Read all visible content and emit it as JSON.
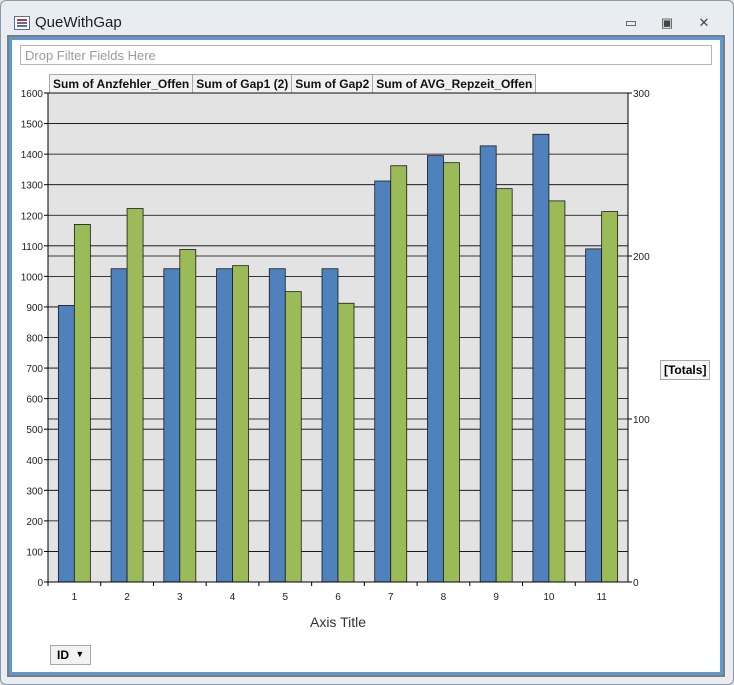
{
  "window": {
    "title": "QueWithGap",
    "minimize": "▭",
    "restore": "▣",
    "close": "✕"
  },
  "filter_placeholder": "Drop Filter Fields Here",
  "data_fields": [
    "Sum of Anzfehler_Offen",
    "Sum of Gap1 (2)",
    "Sum of Gap2",
    "Sum of AVG_Repzeit_Offen"
  ],
  "series_field": "[Totals]",
  "category_field": {
    "label": "ID",
    "arrow": "▼"
  },
  "colors": {
    "blue": "#4f81bd",
    "green": "#9bbb59",
    "plot_bg": "#e3e3e3"
  },
  "chart_data": {
    "type": "bar",
    "xlabel": "Axis Title",
    "categories": [
      "1",
      "2",
      "3",
      "4",
      "5",
      "6",
      "7",
      "8",
      "9",
      "10",
      "11"
    ],
    "left_axis": {
      "ylim": [
        0,
        1600
      ],
      "ticks": [
        "0",
        "100",
        "200",
        "300",
        "400",
        "500",
        "600",
        "700",
        "800",
        "900",
        "1000",
        "1100",
        "1200",
        "1300",
        "1400",
        "1500",
        "1600"
      ]
    },
    "right_axis": {
      "ylim": [
        0,
        300
      ],
      "ticks": [
        "0",
        "100",
        "200",
        "300"
      ]
    },
    "grid": true,
    "series": [
      {
        "name": "Sum of Anzfehler_Offen",
        "color": "#4f81bd",
        "values": [
          905,
          1025,
          1025,
          1025,
          1025,
          1025,
          1312,
          1395,
          1427,
          1465,
          1090
        ]
      },
      {
        "name": "Sum of Gap1 (2)",
        "color": "#9bbb59",
        "values": [
          1170,
          1222,
          1088,
          1035,
          950,
          912,
          1362,
          1372,
          1287,
          1247,
          1212
        ]
      }
    ]
  }
}
